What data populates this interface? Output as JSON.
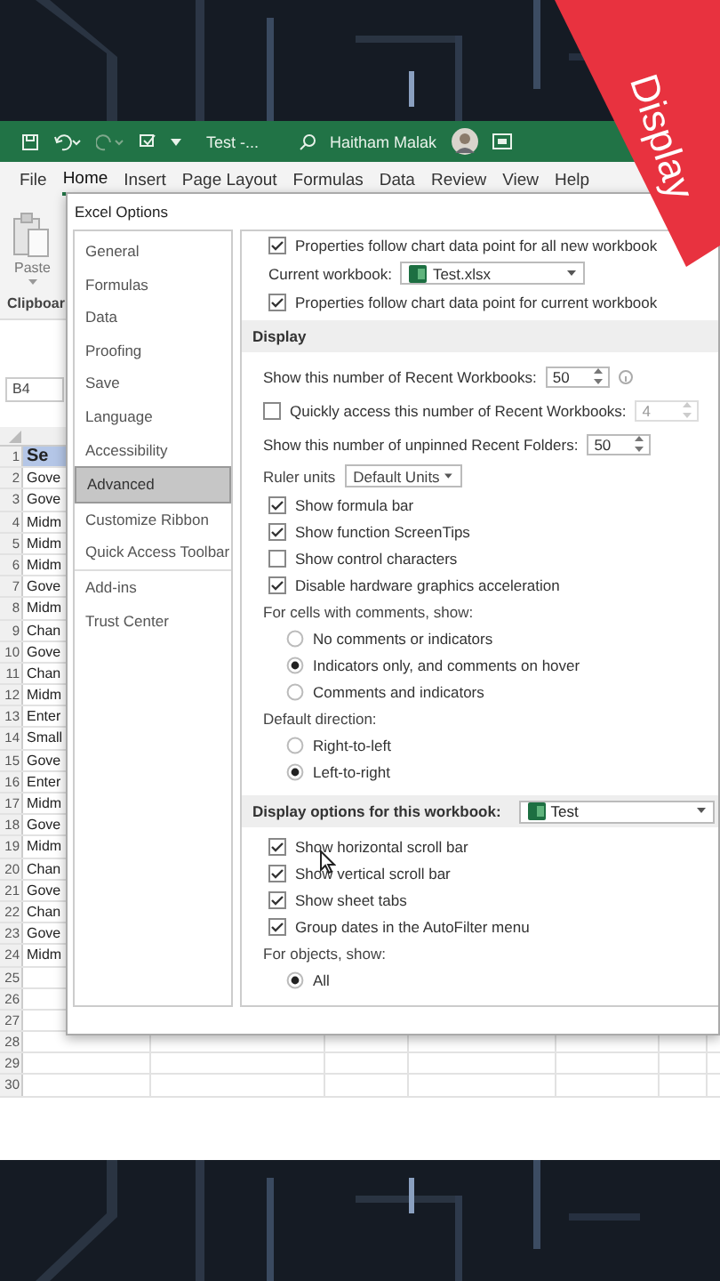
{
  "title_bar": {
    "document_title": "Test -...",
    "user_name": "Haitham Malak"
  },
  "menu_tabs": [
    {
      "label": "File",
      "selected": false
    },
    {
      "label": "Home",
      "selected": true
    },
    {
      "label": "Insert",
      "selected": false
    },
    {
      "label": "Page Layout",
      "selected": false
    },
    {
      "label": "Formulas",
      "selected": false
    },
    {
      "label": "Data",
      "selected": false
    },
    {
      "label": "Review",
      "selected": false
    },
    {
      "label": "View",
      "selected": false
    },
    {
      "label": "Help",
      "selected": false
    }
  ],
  "ribbon": {
    "paste_label": "Paste",
    "group_label": "Clipboar"
  },
  "name_box": "B4",
  "sheet": {
    "rows": [
      {
        "number": "1",
        "kind": "header",
        "cell": "Se"
      },
      {
        "number": "2",
        "kind": "data",
        "cell": "Gove"
      },
      {
        "number": "3",
        "kind": "data",
        "cell": "Gove"
      },
      {
        "number": "4",
        "kind": "data",
        "cell": "Midm"
      },
      {
        "number": "5",
        "kind": "data",
        "cell": "Midm"
      },
      {
        "number": "6",
        "kind": "data",
        "cell": "Midm"
      },
      {
        "number": "7",
        "kind": "data",
        "cell": "Gove"
      },
      {
        "number": "8",
        "kind": "data",
        "cell": "Midm"
      },
      {
        "number": "9",
        "kind": "data",
        "cell": "Chan"
      },
      {
        "number": "10",
        "kind": "data",
        "cell": "Gove"
      },
      {
        "number": "11",
        "kind": "data",
        "cell": "Chan"
      },
      {
        "number": "12",
        "kind": "data",
        "cell": "Midm"
      },
      {
        "number": "13",
        "kind": "data",
        "cell": "Enter"
      },
      {
        "number": "14",
        "kind": "data",
        "cell": "Small"
      },
      {
        "number": "15",
        "kind": "data",
        "cell": "Gove"
      },
      {
        "number": "16",
        "kind": "data",
        "cell": "Enter"
      },
      {
        "number": "17",
        "kind": "data",
        "cell": "Midm"
      },
      {
        "number": "18",
        "kind": "data",
        "cell": "Gove"
      },
      {
        "number": "19",
        "kind": "data",
        "cell": "Midm"
      },
      {
        "number": "20",
        "kind": "data",
        "cell": "Chan"
      },
      {
        "number": "21",
        "kind": "data",
        "cell": "Gove"
      },
      {
        "number": "22",
        "kind": "data",
        "cell": "Chan"
      },
      {
        "number": "23",
        "kind": "data",
        "cell": "Gove"
      },
      {
        "number": "24",
        "kind": "data",
        "cell": "Midm"
      },
      {
        "number": "25",
        "kind": "data"
      },
      {
        "number": "26",
        "kind": "data"
      },
      {
        "number": "27",
        "kind": "data"
      },
      {
        "number": "28",
        "kind": "data"
      },
      {
        "number": "29",
        "kind": "data"
      },
      {
        "number": "30",
        "kind": "data"
      }
    ]
  },
  "dialog": {
    "title": "Excel Options",
    "nav": [
      {
        "label": "General",
        "selected": false,
        "separator_before": false
      },
      {
        "label": "Formulas",
        "selected": false,
        "separator_before": false
      },
      {
        "label": "Data",
        "selected": false,
        "separator_before": false
      },
      {
        "label": "Proofing",
        "selected": false,
        "separator_before": false
      },
      {
        "label": "Save",
        "selected": false,
        "separator_before": false
      },
      {
        "label": "Language",
        "selected": false,
        "separator_before": false
      },
      {
        "label": "Accessibility",
        "selected": false,
        "separator_before": false
      },
      {
        "label": "Advanced",
        "selected": true,
        "separator_before": false
      },
      {
        "label": "Customize Ribbon",
        "selected": false,
        "separator_before": false
      },
      {
        "label": "Quick Access Toolbar",
        "selected": false,
        "separator_before": false
      },
      {
        "label": "Add-ins",
        "selected": false,
        "separator_before": true
      },
      {
        "label": "Trust Center",
        "selected": false,
        "separator_before": false
      }
    ],
    "options": [
      {
        "kind": "checkbox",
        "label": "Properties follow chart data point for all new workbook",
        "checked": true
      },
      {
        "kind": "workbook_select",
        "label": "Current workbook:",
        "value": "Test.xlsx"
      },
      {
        "kind": "checkbox",
        "label": "Properties follow chart data point for current workbook",
        "checked": true
      },
      {
        "kind": "heading",
        "label": "Display"
      },
      {
        "kind": "spin",
        "label": "Show this number of Recent Workbooks:",
        "value": "50",
        "info": true
      },
      {
        "kind": "check_spin",
        "label": "Quickly access this number of Recent Workbooks:",
        "checked": false,
        "value": "4",
        "disabled": true
      },
      {
        "kind": "spin",
        "label": "Show this number of unpinned Recent Folders:",
        "value": "50",
        "info": false
      },
      {
        "kind": "select",
        "label": "Ruler units",
        "value": "Default Units"
      },
      {
        "kind": "checkbox",
        "label": "Show formula bar",
        "checked": true
      },
      {
        "kind": "checkbox",
        "label": "Show function ScreenTips",
        "checked": true
      },
      {
        "kind": "checkbox",
        "label": "Show control characters",
        "checked": false
      },
      {
        "kind": "checkbox",
        "label": "Disable hardware graphics acceleration",
        "checked": true
      },
      {
        "kind": "note",
        "label": "For cells with comments, show:"
      },
      {
        "kind": "radio",
        "label": "No comments or indicators",
        "selected": false
      },
      {
        "kind": "radio",
        "label": "Indicators only, and comments on hover",
        "selected": true
      },
      {
        "kind": "radio",
        "label": "Comments and indicators",
        "selected": false
      },
      {
        "kind": "note",
        "label": "Default direction:"
      },
      {
        "kind": "radio",
        "label": "Right-to-left",
        "selected": false
      },
      {
        "kind": "radio",
        "label": "Left-to-right",
        "selected": true
      },
      {
        "kind": "heading_select",
        "label": "Display options for this workbook:",
        "value": "Test"
      },
      {
        "kind": "checkbox",
        "label": "Show horizontal scroll bar",
        "checked": true
      },
      {
        "kind": "checkbox",
        "label": "Show vertical scroll bar",
        "checked": true
      },
      {
        "kind": "checkbox",
        "label": "Show sheet tabs",
        "checked": true
      },
      {
        "kind": "checkbox",
        "label": "Group dates in the AutoFilter menu",
        "checked": true
      },
      {
        "kind": "note",
        "label": "For objects, show:"
      },
      {
        "kind": "radio",
        "label": "All",
        "selected": true
      }
    ]
  },
  "banner": {
    "text": "Display"
  }
}
